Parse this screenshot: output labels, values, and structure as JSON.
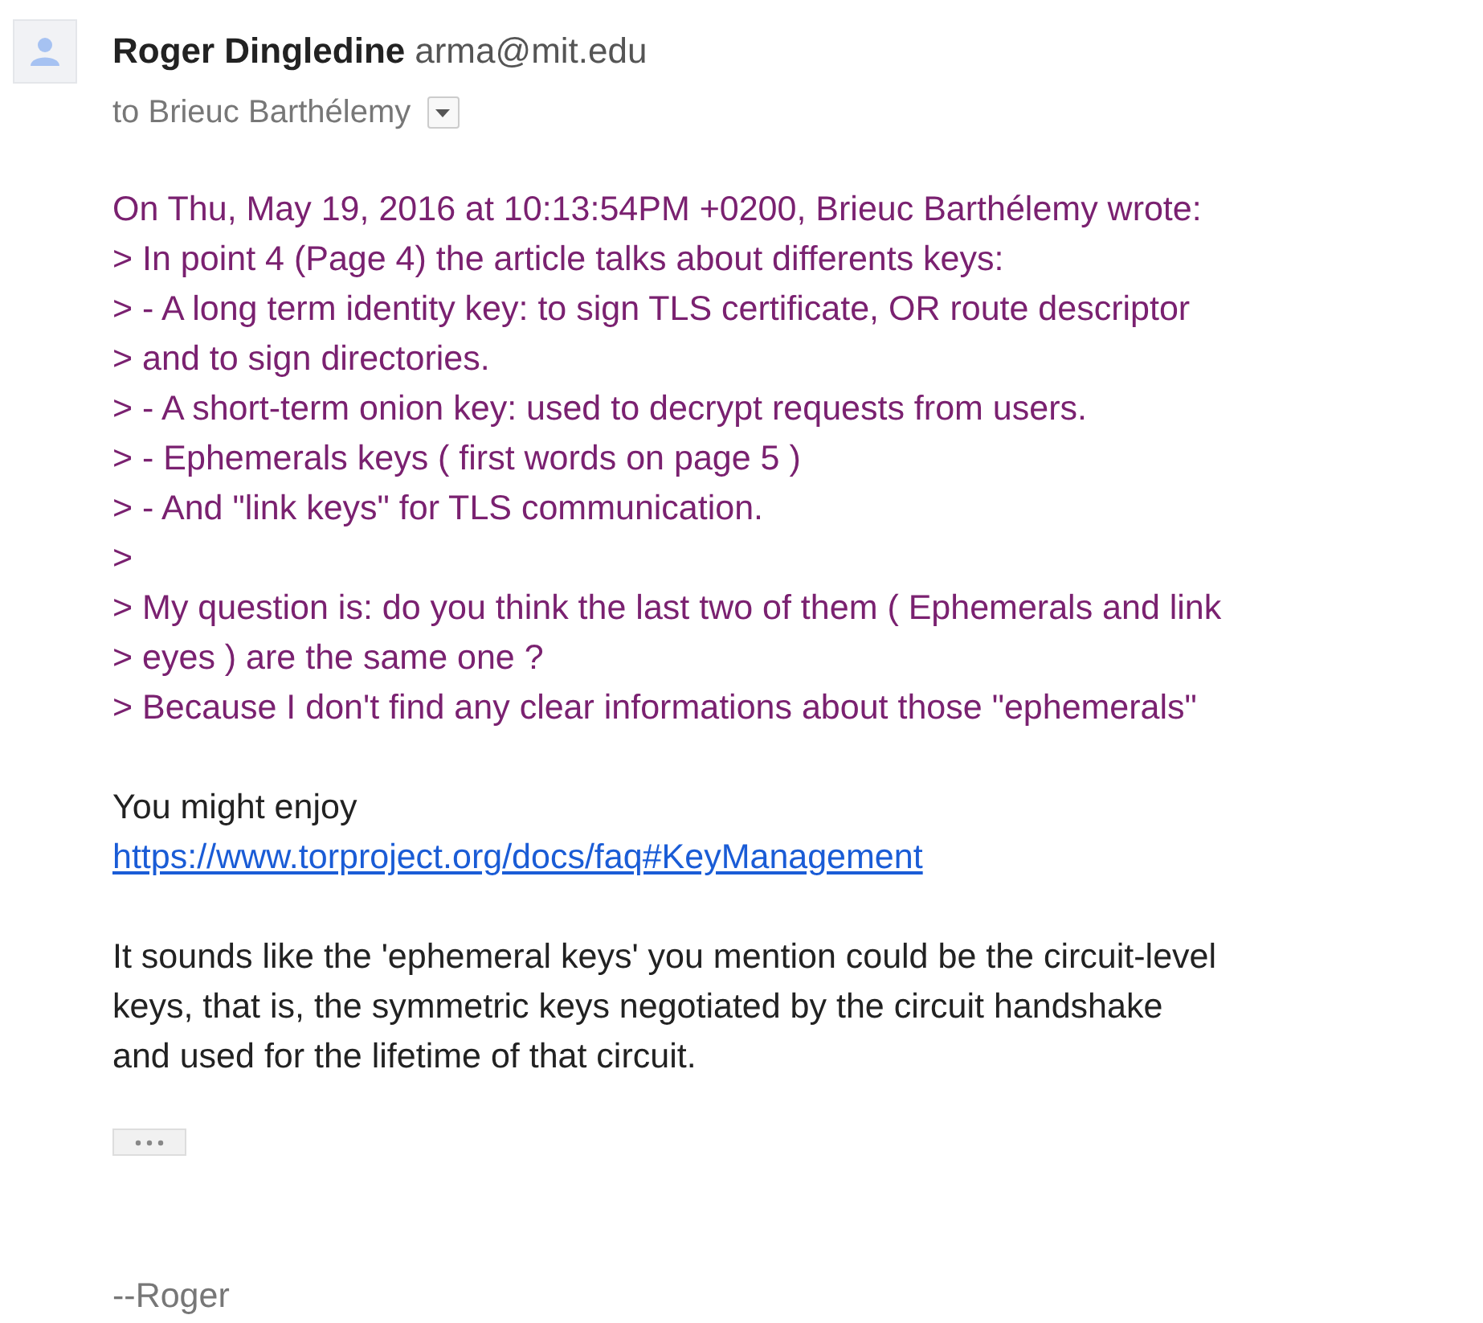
{
  "sender": {
    "name": "Roger Dingledine",
    "email": "arma@mit.edu"
  },
  "recipient": "to Brieuc Barthélemy",
  "quote": [
    "On Thu, May 19, 2016 at 10:13:54PM +0200, Brieuc Barthélemy wrote:",
    "> In point 4 (Page 4) the article talks about differents keys:",
    "> - A long term identity key: to sign TLS certificate, OR route descriptor",
    "> and to sign directories.",
    "> - A short-term onion key: used to decrypt requests from users.",
    "> - Ephemerals keys ( first words on page 5 )",
    "> - And \"link keys\" for TLS communication.",
    ">",
    "> My question is: do you think the last two of them ( Ephemerals and link",
    "> eyes ) are the same one ?",
    "> Because I don't find any clear informations about those \"ephemerals\""
  ],
  "intro": "You might enjoy",
  "link": "https://www.torproject.org/docs/faq#KeyManagement",
  "paragraph": "It sounds like the 'ephemeral keys' you mention could be the circuit-level\nkeys, that is, the symmetric keys negotiated by the circuit handshake\nand used for the lifetime of that circuit.",
  "signature": "--Roger"
}
